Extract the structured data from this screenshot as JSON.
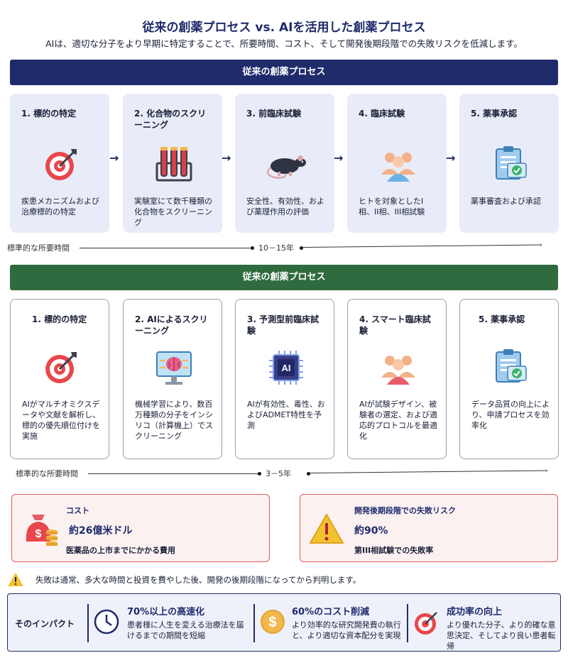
{
  "header": {
    "title": "従来の創薬プロセス vs. AIを活用した創薬プロセス",
    "subtitle": "AIは、適切な分子をより早期に特定することで、所要時間、コスト、そして開発後期段階での失敗リスクを低減します。"
  },
  "traditional": {
    "banner": "従来の創薬プロセス",
    "steps": [
      {
        "title": "1. 標的の特定",
        "icon": "target-icon",
        "desc": "疾患メカニズムおよび治療標的の特定"
      },
      {
        "title": "2. 化合物のスクリーニング",
        "icon": "test-tubes-icon",
        "desc": "実験室にて数千種類の化合物をスクリーニング"
      },
      {
        "title": "3. 前臨床試験",
        "icon": "rat-icon",
        "desc": "安全性、有効性、および薬理作用の評価"
      },
      {
        "title": "4. 臨床試験",
        "icon": "people-icon",
        "desc": "ヒトを対象としたI相、II相、III相試験"
      },
      {
        "title": "5. 薬事承認",
        "icon": "clipboard-check-icon",
        "desc": "薬事審査および承認"
      }
    ],
    "timeline_label": "標準的な所要時間",
    "timeline_value": "10－15年"
  },
  "ai": {
    "banner": "従来の創薬プロセス",
    "steps": [
      {
        "title": "1. 標的の特定",
        "icon": "target-icon",
        "desc": "AIがマルチオミクスデータや文献を解析し、標的の優先順位付けを実施"
      },
      {
        "title": "2. AIによるスクリーニング",
        "icon": "brain-monitor-icon",
        "desc": "機械学習により、数百万種類の分子をインシリコ（計算機上）でスクリーニング"
      },
      {
        "title": "3. 予測型前臨床試験",
        "icon": "ai-chip-icon",
        "desc": "AIが有効性、毒性、およびADMET特性を予測"
      },
      {
        "title": "4. スマート臨床試験",
        "icon": "people-icon",
        "desc": "AIが試験デザイン、被験者の選定、および適応的プロトコルを最適化"
      },
      {
        "title": "5. 薬事承認",
        "icon": "clipboard-check-icon",
        "desc": "データ品質の向上により、申請プロセスを効率化"
      }
    ],
    "timeline_label": "標準的な所要時間",
    "timeline_value": "3－5年",
    "ai_chip_text": "AI"
  },
  "stats": {
    "cost": {
      "title": "コスト",
      "value": "約26億米ドル",
      "note": "医薬品の上市までにかかる費用",
      "icon": "money-bag-icon"
    },
    "risk": {
      "title": "開発後期段階での失敗リスク",
      "value": "約90%",
      "note": "第III相試験での失敗率",
      "icon": "warning-icon"
    }
  },
  "warning": {
    "text": "失敗は通常、多大な時間と投資を費やした後、開発の後期段階になってから判明します。",
    "icon": "warning-icon"
  },
  "impact": {
    "label": "そのインパクト",
    "items": [
      {
        "head": "70%以上の高速化",
        "desc": "患者様に人生を変える治療法を届けるまでの期間を短縮",
        "icon": "clock-icon"
      },
      {
        "head": "60%のコスト削減",
        "desc": "より効率的な研究開発費の執行と、より適切な資本配分を実現",
        "icon": "dollar-coin-icon"
      },
      {
        "head": "成功率の向上",
        "desc": "より優れた分子、より的確な意思決定、そしてより良い患者転帰",
        "icon": "target-icon"
      }
    ]
  },
  "colors": {
    "navy": "#1f2b6b",
    "green": "#2f6b3f",
    "red": "#e05a5a",
    "card_bg": "#e8ecf8"
  }
}
